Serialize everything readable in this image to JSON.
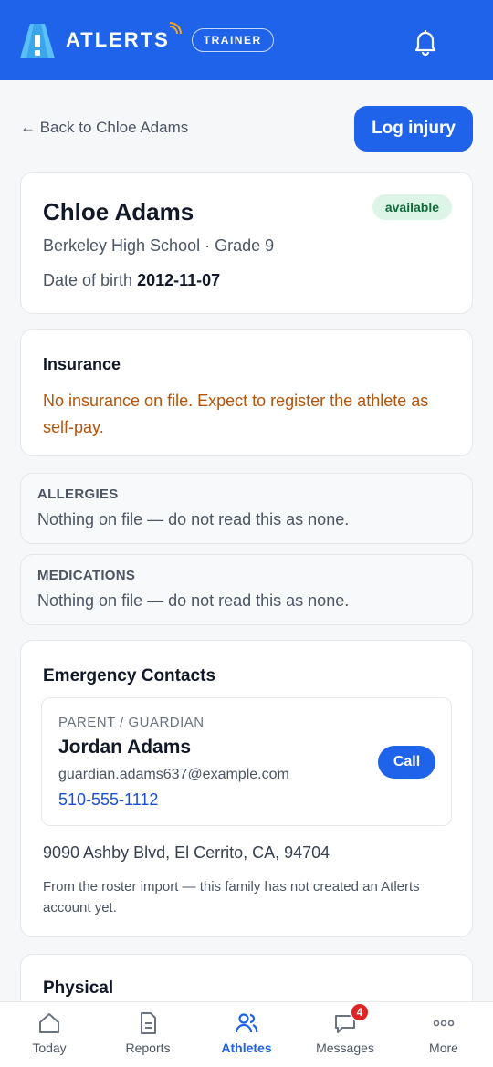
{
  "header": {
    "brand": "ATLERTS",
    "role": "TRAINER",
    "colors": {
      "brand_blue": "#1e63e9"
    }
  },
  "actions": {
    "back_label": "← Back to Chloe Adams",
    "log_injury_label": "Log injury"
  },
  "athlete": {
    "name": "Chloe Adams",
    "status": "available",
    "school_grade": "Berkeley High School · Grade 9",
    "dob_label": "Date of birth",
    "dob_value": "2012-11-07"
  },
  "insurance": {
    "title": "Insurance",
    "message": "No insurance on file. Expect to register the athlete as self-pay."
  },
  "allergies": {
    "label": "ALLERGIES",
    "text": "Nothing on file — do not read this as none."
  },
  "medications": {
    "label": "MEDICATIONS",
    "text": "Nothing on file — do not read this as none."
  },
  "emergency": {
    "title": "Emergency Contacts",
    "contact": {
      "relation": "PARENT / GUARDIAN",
      "name": "Jordan Adams",
      "email": "guardian.adams637@example.com",
      "phone": "510-555-1112",
      "call_label": "Call"
    },
    "address": "9090 Ashby Blvd, El Cerrito, CA, 94704",
    "note": "From the roster import — this family has not created an Atlerts account yet."
  },
  "physical": {
    "title": "Physical"
  },
  "nav": {
    "items": [
      {
        "label": "Today",
        "icon": "home-icon"
      },
      {
        "label": "Reports",
        "icon": "document-icon"
      },
      {
        "label": "Athletes",
        "icon": "users-icon",
        "active": true
      },
      {
        "label": "Messages",
        "icon": "chat-icon",
        "badge": "4"
      },
      {
        "label": "More",
        "icon": "more-icon"
      }
    ]
  }
}
